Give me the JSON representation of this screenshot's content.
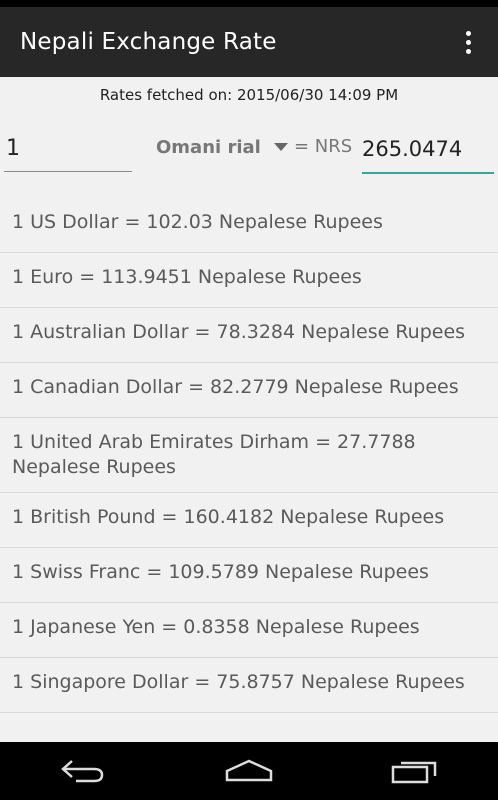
{
  "app": {
    "title": "Nepali Exchange Rate"
  },
  "fetched_text": "Rates fetched on: 2015/06/30 14:09 PM",
  "converter": {
    "amount": "1",
    "currency": "Omani rial",
    "equals_label": "= NRS",
    "result": "265.0474"
  },
  "rates": [
    "1 US Dollar = 102.03 Nepalese Rupees",
    "1 Euro = 113.9451 Nepalese Rupees",
    "1 Australian Dollar = 78.3284 Nepalese Rupees",
    "1 Canadian Dollar = 82.2779 Nepalese Rupees",
    "1 United Arab Emirates Dirham = 27.7788 Nepalese Rupees",
    "1 British Pound = 160.4182 Nepalese Rupees",
    "1 Swiss Franc = 109.5789 Nepalese Rupees",
    "1 Japanese Yen = 0.8358 Nepalese Rupees",
    "1 Singapore Dollar = 75.8757 Nepalese Rupees"
  ],
  "icons": {
    "overflow": "more-vert-icon",
    "back": "back-icon",
    "home": "home-icon",
    "recents": "recents-icon"
  },
  "colors": {
    "appbar": "#272727",
    "accent": "#33a8a0",
    "background": "#f1f1f1"
  }
}
